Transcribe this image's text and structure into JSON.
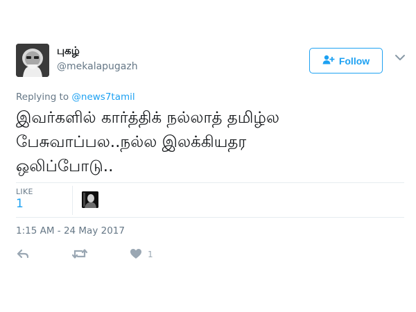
{
  "user": {
    "display_name": "புகழ்",
    "handle": "@mekalapugazh"
  },
  "follow": {
    "label": "Follow"
  },
  "reply": {
    "prefix": "Replying to",
    "mention": "@news7tamil"
  },
  "tweet": {
    "text": "இவர்களில் கார்த்திக் நல்லாத் தமிழ்ல\nபேசுவாப்பல..நல்ல இலக்கியதர\nஒலிப்போடு.."
  },
  "stats": {
    "likes_label": "LIKE",
    "likes_count": "1"
  },
  "timestamp": "1:15 AM - 24 May 2017",
  "actions": {
    "like_count": "1"
  },
  "colors": {
    "accent": "#1da1f2",
    "muted": "#657786",
    "icon": "#9aa7b3"
  },
  "icons": [
    "avatar-photo",
    "person-add-icon",
    "chevron-down-icon",
    "reply-icon",
    "retweet-icon",
    "heart-icon"
  ]
}
